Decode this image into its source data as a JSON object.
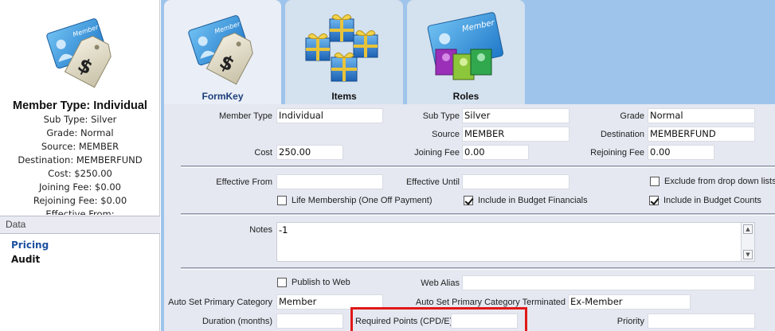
{
  "left_panel": {
    "summary": {
      "title": "Member Type: Individual",
      "sub_type": "Sub Type: Silver",
      "grade": "Grade: Normal",
      "source": "Source: MEMBER",
      "destination": "Destination: MEMBERFUND",
      "cost": "Cost: $250.00",
      "joining_fee": "Joining Fee: $0.00",
      "rejoining_fee": "Rejoining Fee: $0.00",
      "effective_from": "Effective From:"
    },
    "data_header": "Data",
    "links": [
      "Pricing",
      "Audit"
    ],
    "card_icon_text": "Member"
  },
  "tabs": [
    {
      "label": "FormKey",
      "active": true
    },
    {
      "label": "Items",
      "active": false
    },
    {
      "label": "Roles",
      "active": false
    }
  ],
  "form": {
    "member_type": {
      "label": "Member Type",
      "value": "Individual"
    },
    "sub_type": {
      "label": "Sub Type",
      "value": "Silver"
    },
    "grade": {
      "label": "Grade",
      "value": "Normal"
    },
    "source": {
      "label": "Source",
      "value": "MEMBER"
    },
    "destination": {
      "label": "Destination",
      "value": "MEMBERFUND"
    },
    "cost": {
      "label": "Cost",
      "value": "250.00"
    },
    "joining_fee": {
      "label": "Joining Fee",
      "value": "0.00"
    },
    "rejoining_fee": {
      "label": "Rejoining Fee",
      "value": "0.00"
    },
    "effective_from": {
      "label": "Effective From",
      "value": ""
    },
    "effective_until": {
      "label": "Effective Until",
      "value": ""
    },
    "exclude_dropdown": {
      "label": "Exclude from drop down lists",
      "checked": false
    },
    "life_membership": {
      "label": "Life Membership (One Off Payment)",
      "checked": false
    },
    "include_budget_financials": {
      "label": "Include in Budget Financials",
      "checked": true
    },
    "include_budget_counts": {
      "label": "Include in Budget Counts",
      "checked": true
    },
    "notes": {
      "label": "Notes",
      "value": "-1"
    },
    "publish_to_web": {
      "label": "Publish to Web",
      "checked": false
    },
    "web_alias": {
      "label": "Web Alias",
      "value": ""
    },
    "auto_primary_category": {
      "label": "Auto Set Primary Category",
      "value": "Member"
    },
    "auto_primary_category_terminated": {
      "label": "Auto Set Primary Category Terminated",
      "value": "Ex-Member"
    },
    "duration": {
      "label": "Duration (months)",
      "value": ""
    },
    "required_points": {
      "label": "Required Points (CPD/E)",
      "value": ""
    },
    "priority": {
      "label": "Priority",
      "value": ""
    }
  },
  "colors": {
    "highlight": "#e01818",
    "link_active": "#1e4fa0",
    "form_bg": "#e5e8f1",
    "tab_strip_bg": "#9ec4eb"
  }
}
